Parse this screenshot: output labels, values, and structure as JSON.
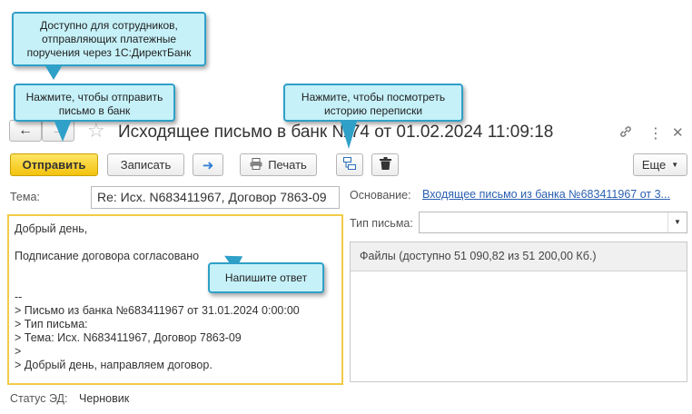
{
  "window": {
    "title": "Исходящее письмо в банк №74 от 01.02.2024 11:09:18",
    "back_icon": "arrow-left-icon",
    "forward_icon": "arrow-right-icon",
    "star_icon": "star-icon",
    "link_icon": "link-icon",
    "menu_icon": "more-vertical-icon",
    "close_icon": "close-icon"
  },
  "toolbar": {
    "send_label": "Отправить",
    "save_label": "Записать",
    "print_label": "Печать",
    "more_label": "Еще"
  },
  "form": {
    "subject_label": "Тема:",
    "subject_value": "Re: Исх. N683411967, Договор 7863-09",
    "basis_label": "Основание:",
    "basis_link": "Входящее письмо из банка №683411967 от 3...",
    "letter_type_label": "Тип письма:",
    "letter_type_value": "",
    "files_header": "Файлы (доступно 51 090,82 из 51 200,00 Кб.)",
    "body_lines": [
      "Добрый день,",
      "",
      "Подписание договора согласовано",
      "",
      "",
      "--",
      "> Письмо из банка №683411967 от 31.01.2024 0:00:00",
      "> Тип письма:",
      "> Тема: Исх. N683411967, Договор 7863-09",
      ">",
      "> Добрый день, направляем договор."
    ],
    "status_label": "Статус ЭД:",
    "status_value": "Черновик"
  },
  "callouts": {
    "directbank": "Доступно для сотрудников, отправляющих платежные поручения через 1С:ДиректБанк",
    "send": "Нажмите, чтобы отправить письмо в банк",
    "history": "Нажмите, чтобы посмотреть историю переписки",
    "reply": "Напишите ответ"
  },
  "colors": {
    "primary_button": "#f3c20c",
    "callout_bg": "#c6f1f9",
    "callout_border": "#2fa0c8",
    "link": "#2a5fb0",
    "body_border": "#f2cb45"
  }
}
